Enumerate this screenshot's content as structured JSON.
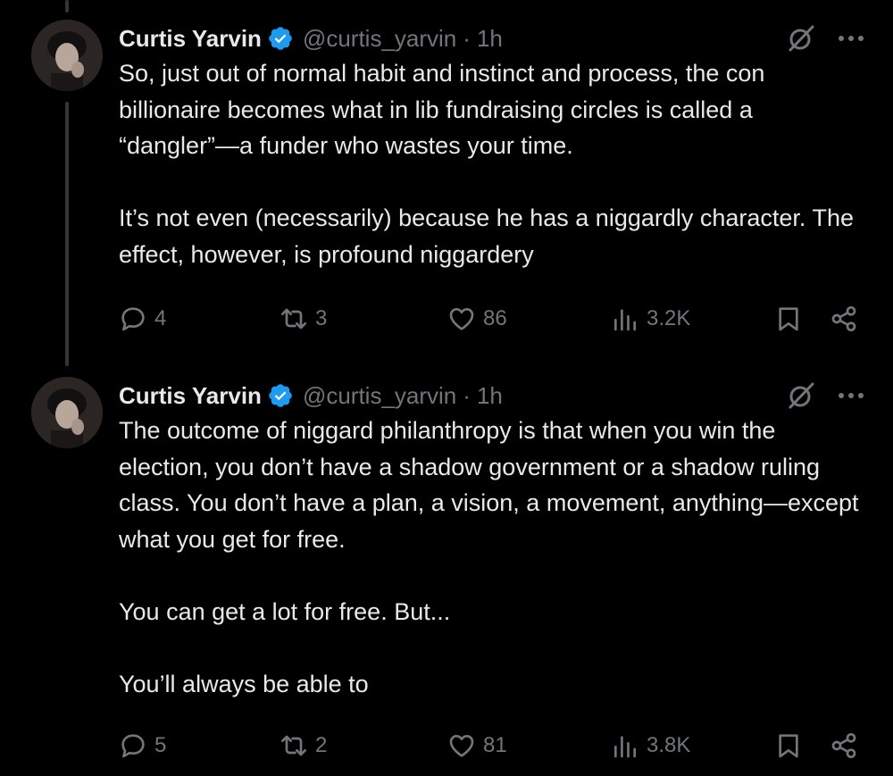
{
  "tweets": [
    {
      "author": {
        "name": "Curtis Yarvin",
        "handle": "@curtis_yarvin",
        "time": "1h"
      },
      "paragraphs": [
        "So, just out of normal habit and instinct and process, the con billionaire becomes what in lib fundraising circles is called a “dangler”—a funder who wastes your time.",
        "It’s not even (necessarily) because he has a niggardly character. The effect, however, is profound niggardery"
      ],
      "stats": {
        "replies": "4",
        "reposts": "3",
        "likes": "86",
        "views": "3.2K"
      }
    },
    {
      "author": {
        "name": "Curtis Yarvin",
        "handle": "@curtis_yarvin",
        "time": "1h"
      },
      "paragraphs": [
        "The outcome of niggard philanthropy is that when you win the election, you don’t have a shadow government or a shadow ruling class. You don’t have a plan, a vision, a movement, anything—except what you get for free.",
        "You can get a lot for free. But...",
        "You’ll always be able to"
      ],
      "stats": {
        "replies": "5",
        "reposts": "2",
        "likes": "81",
        "views": "3.8K"
      }
    }
  ],
  "separator": "·",
  "icons": {
    "reply": "reply-icon",
    "repost": "repost-icon",
    "like": "heart-icon",
    "views": "views-icon",
    "bookmark": "bookmark-icon",
    "share": "share-icon",
    "verified": "verified-badge-icon",
    "grok": "grok-icon",
    "more": "more-icon"
  },
  "colors": {
    "background": "#000000",
    "text": "#e7e9ea",
    "muted": "#71767b",
    "verified": "#1d9bf0"
  }
}
